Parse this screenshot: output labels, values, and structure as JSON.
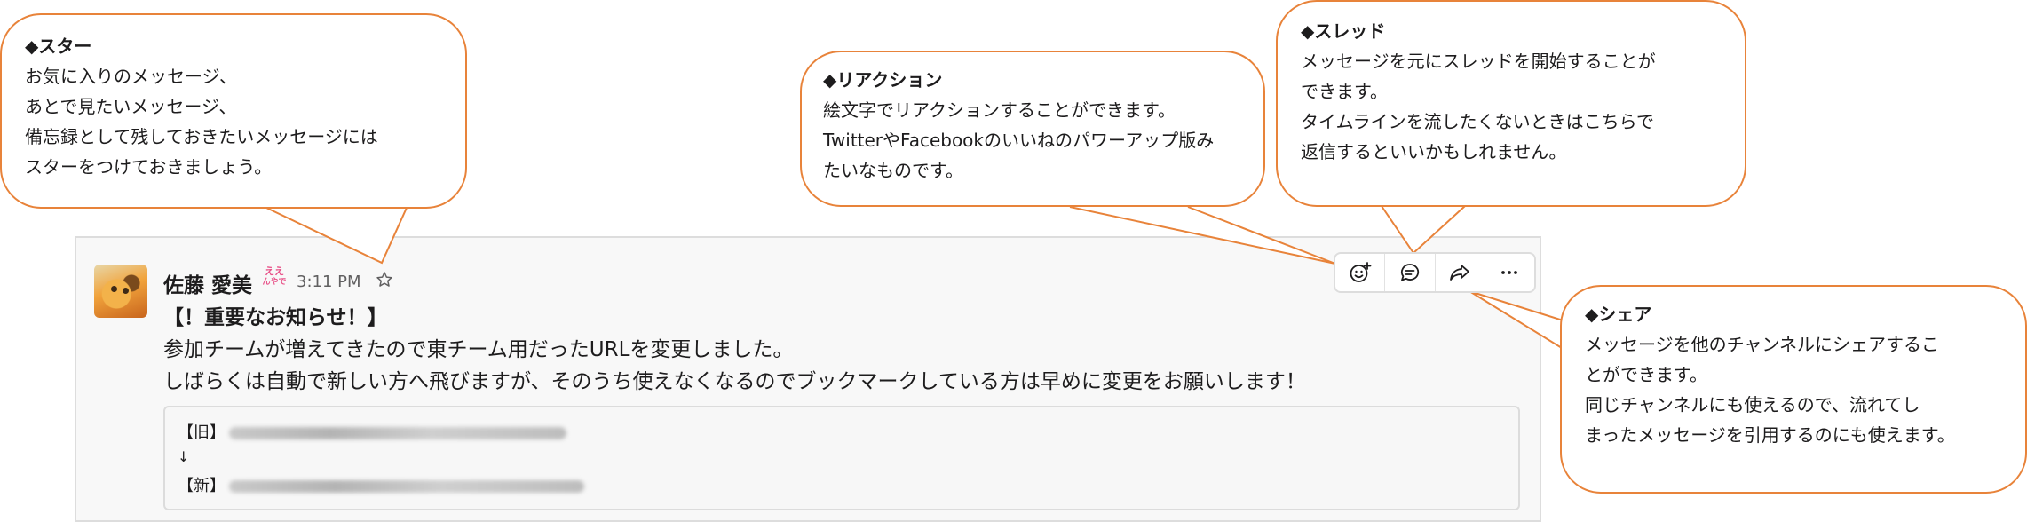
{
  "callouts": {
    "star": {
      "title": "◆スター",
      "lines": [
        "お気に入りのメッセージ、",
        "あとで見たいメッセージ、",
        "備忘録として残しておきたいメッセージには",
        "スターをつけておきましょう。"
      ]
    },
    "reaction": {
      "title": "◆リアクション",
      "lines": [
        "絵文字でリアクションすることができます。",
        "TwitterやFacebookのいいねのパワーアップ版み",
        "たいなものです。"
      ]
    },
    "thread": {
      "title": "◆スレッド",
      "lines": [
        "メッセージを元にスレッドを開始することが",
        "できます。",
        "タイムラインを流したくないときはこちらで",
        "返信するといいかもしれません。"
      ]
    },
    "share": {
      "title": "◆シェア",
      "lines": [
        "メッセージを他のチャンネルにシェアするこ",
        "とができます。",
        "同じチャンネルにも使えるので、流れてし",
        "まったメッセージを引用するのにも使えます。"
      ]
    }
  },
  "message": {
    "author": "佐藤 愛美",
    "status_emoji_text": [
      "ええ",
      "んやで"
    ],
    "time": "3:11 PM",
    "lines": [
      "【！重要なお知らせ！】",
      "参加チームが増えてきたので東チーム用だったURLを変更しました。",
      "しばらくは自動で新しい方へ飛びますが、そのうち使えなくなるのでブックマークしている方は早めに変更をお願いします！"
    ],
    "quote": {
      "old_label": "【旧】",
      "arrow": "↓",
      "new_label": "【新】"
    }
  },
  "toolbar": {
    "icons": [
      "add-reaction-icon",
      "thread-icon",
      "share-icon",
      "more-icon"
    ]
  },
  "colors": {
    "accent": "#e8833a",
    "status": "#e8548a"
  }
}
